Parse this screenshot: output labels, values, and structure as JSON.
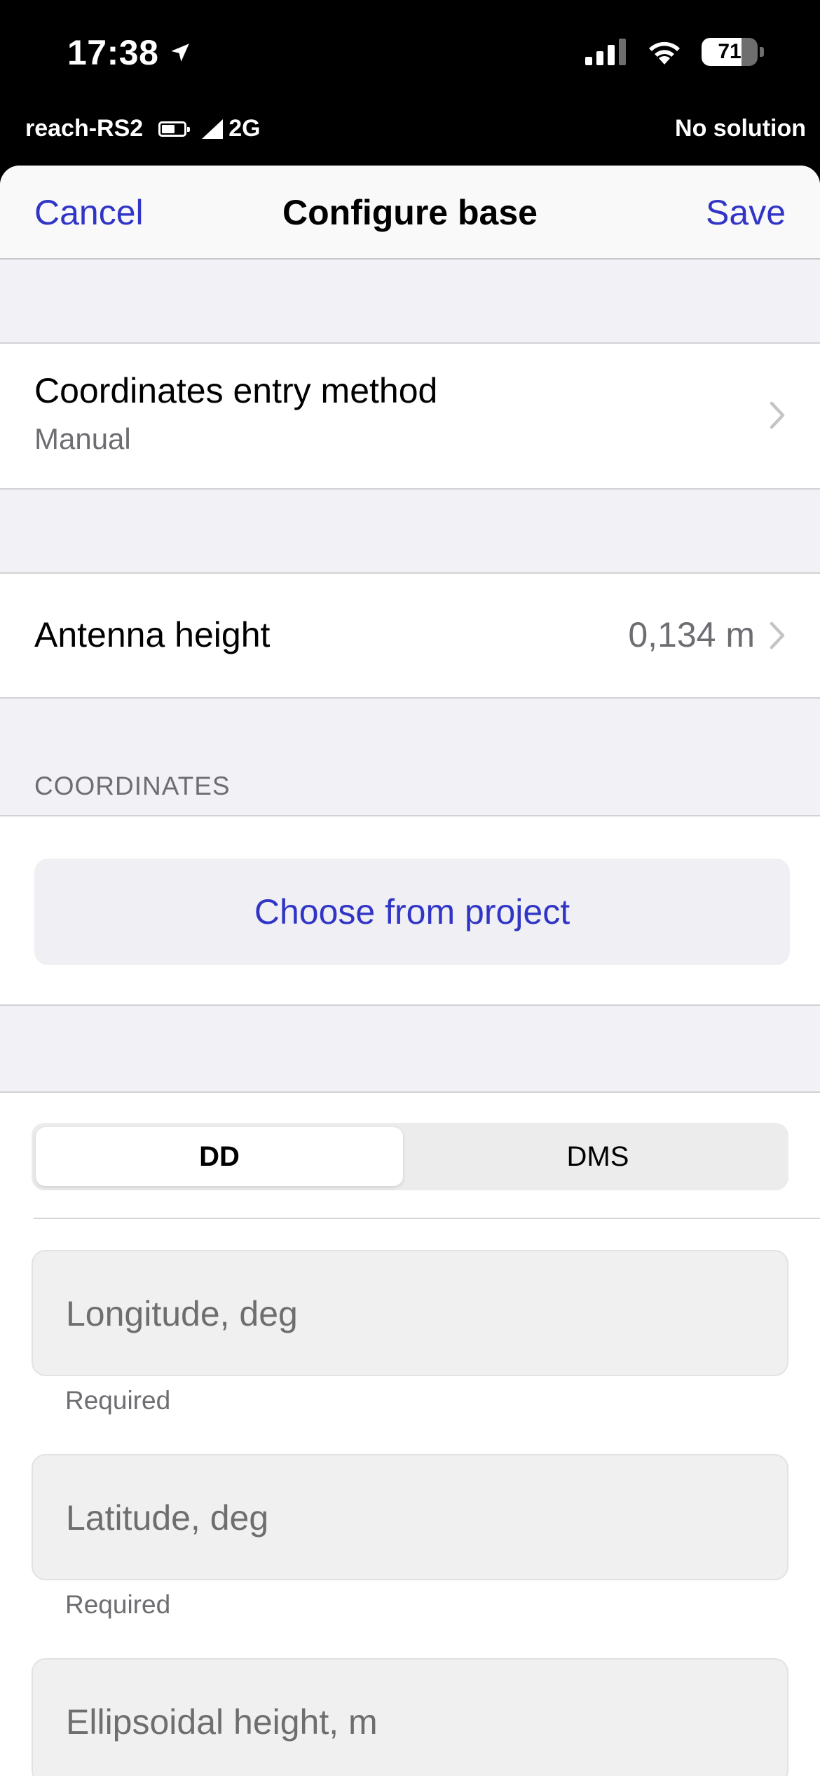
{
  "status_bar": {
    "time": "17:38",
    "battery_percent": 71,
    "battery_label": "71"
  },
  "device_bar": {
    "device_name": "reach-RS2",
    "network": "2G",
    "solution_status": "No solution"
  },
  "nav": {
    "cancel_label": "Cancel",
    "title": "Configure base",
    "save_label": "Save"
  },
  "entry_method": {
    "title": "Coordinates entry method",
    "value": "Manual"
  },
  "antenna": {
    "title": "Antenna height",
    "value": "0,134 m"
  },
  "coordinates": {
    "section_header": "COORDINATES",
    "choose_button": "Choose from project"
  },
  "format_toggle": {
    "options": [
      "DD",
      "DMS"
    ],
    "selected": "DD"
  },
  "fields": [
    {
      "placeholder": "Longitude, deg",
      "helper": "Required"
    },
    {
      "placeholder": "Latitude, deg",
      "helper": "Required"
    },
    {
      "placeholder": "Ellipsoidal height, m",
      "helper": ""
    }
  ],
  "colors": {
    "accent": "#3135c6",
    "background": "#f1f1f6",
    "secondary_text": "#6d6d72"
  }
}
